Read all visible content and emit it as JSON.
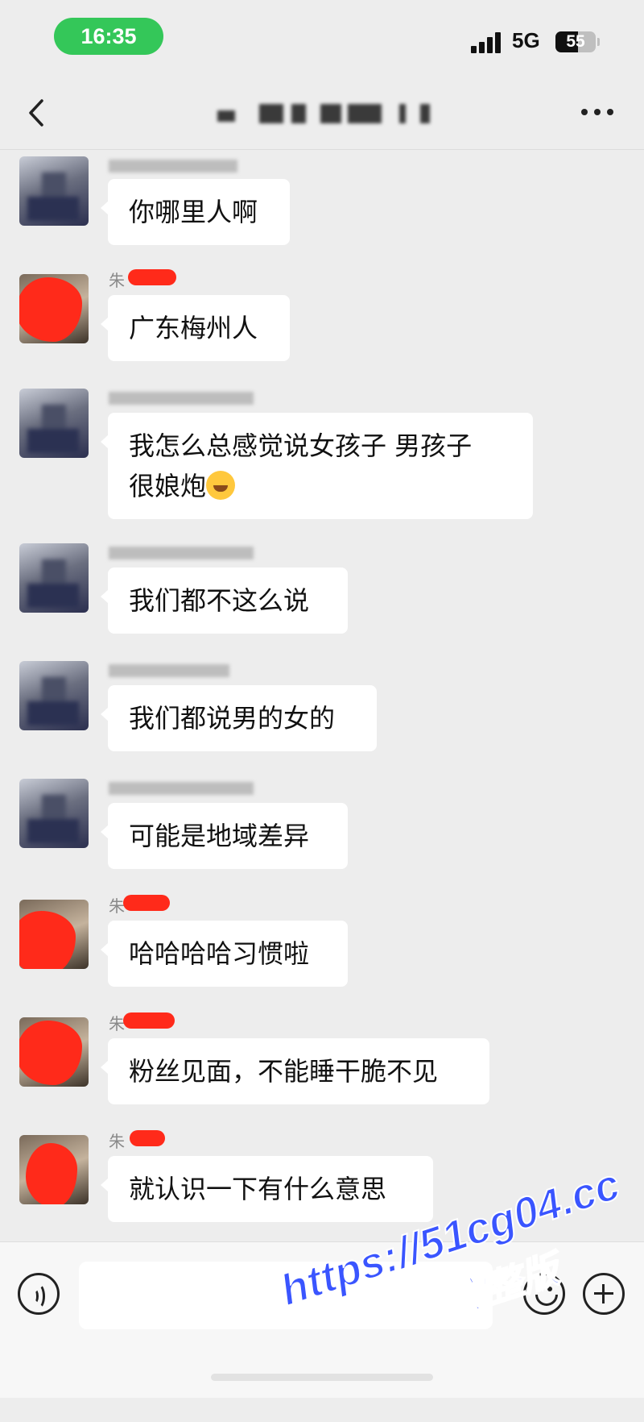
{
  "status_bar": {
    "time": "16:35",
    "network": "5G",
    "battery_level": "55",
    "battery_fraction": 0.55
  },
  "nav": {
    "back_icon": "chevron-left-icon",
    "more_icon": "ellipsis-icon"
  },
  "messages": [
    {
      "sender": "",
      "text": "你哪里人啊",
      "avatar": "pixelated"
    },
    {
      "sender": "朱",
      "text": "广东梅州人",
      "avatar": "redacted"
    },
    {
      "sender": "",
      "text": "我怎么总感觉说女孩子 男孩子",
      "text2": "很娘炮",
      "emoji": "laughing-crying-emoji",
      "avatar": "pixelated"
    },
    {
      "sender": "",
      "text": "我们都不这么说",
      "avatar": "pixelated"
    },
    {
      "sender": "",
      "text": "我们都说男的女的",
      "avatar": "pixelated"
    },
    {
      "sender": "",
      "text": "可能是地域差异",
      "avatar": "pixelated"
    },
    {
      "sender": "朱",
      "text": "哈哈哈哈习惯啦",
      "avatar": "redacted"
    },
    {
      "sender": "朱",
      "text": "粉丝见面，不能睡干脆不见",
      "avatar": "redacted"
    },
    {
      "sender": "朱",
      "text": "就认识一下有什么意思",
      "avatar": "redacted"
    }
  ],
  "input_bar": {
    "voice_icon": "voice-icon",
    "emoji_icon": "emoji-icon",
    "plus_icon": "plus-icon",
    "placeholder": ""
  },
  "watermark": {
    "url": "https://51cg04.cc",
    "text": "看完整版"
  },
  "colors": {
    "background": "#ededed",
    "bubble": "#ffffff",
    "time_pill": "#34c759",
    "redaction": "#ff2a1a",
    "watermark": "#3a55ff"
  }
}
